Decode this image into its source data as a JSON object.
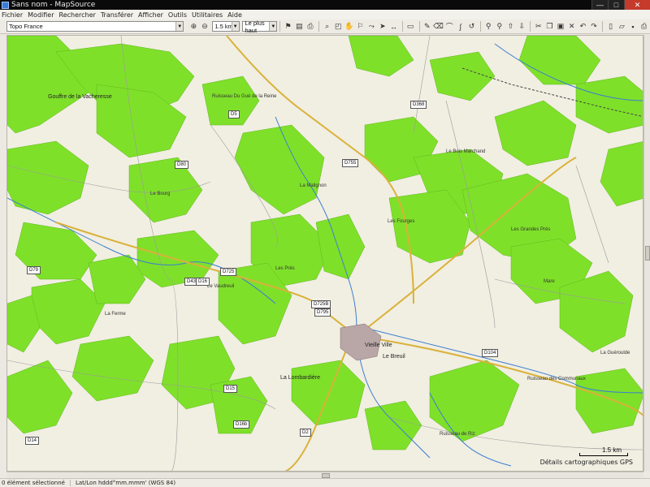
{
  "window": {
    "title": "Sans nom - MapSource"
  },
  "menu": [
    "Fichier",
    "Modifier",
    "Rechercher",
    "Transférer",
    "Afficher",
    "Outils",
    "Utilitaires",
    "Aide"
  ],
  "toolbar": {
    "map_product": "Topo France",
    "zoom_scale": "1.5 km",
    "detail_level": "Le plus haut"
  },
  "map": {
    "places": [
      "Gouffre de la Vacheresse",
      "La Malignon",
      "Ruisseau Du Gué de la Reine",
      "Vieille Ville",
      "La Lombardière",
      "Le Breuil",
      "Ruisseau de Riz",
      "La Guéroulde",
      "Les Grandes Prés",
      "Ruisseau des Communaux",
      "Le Bois Marchand",
      "Les Fourges",
      "Le Vaudreuil",
      "Les Prés",
      "La Ferme",
      "Mare",
      "Le Bourg"
    ],
    "roads": [
      "D5",
      "D80",
      "D755",
      "D725",
      "D434",
      "D16",
      "D725B",
      "D79",
      "D104",
      "D15",
      "D14",
      "D2",
      "D16b",
      "D368",
      "D795"
    ],
    "scale_label": "1.5 km",
    "attribution": "Détails cartographiques GPS"
  },
  "status": {
    "selection": "0 élément sélectionné",
    "coord_format": "Lat/Lon hddd°mm.mmm' (WGS 84)"
  }
}
